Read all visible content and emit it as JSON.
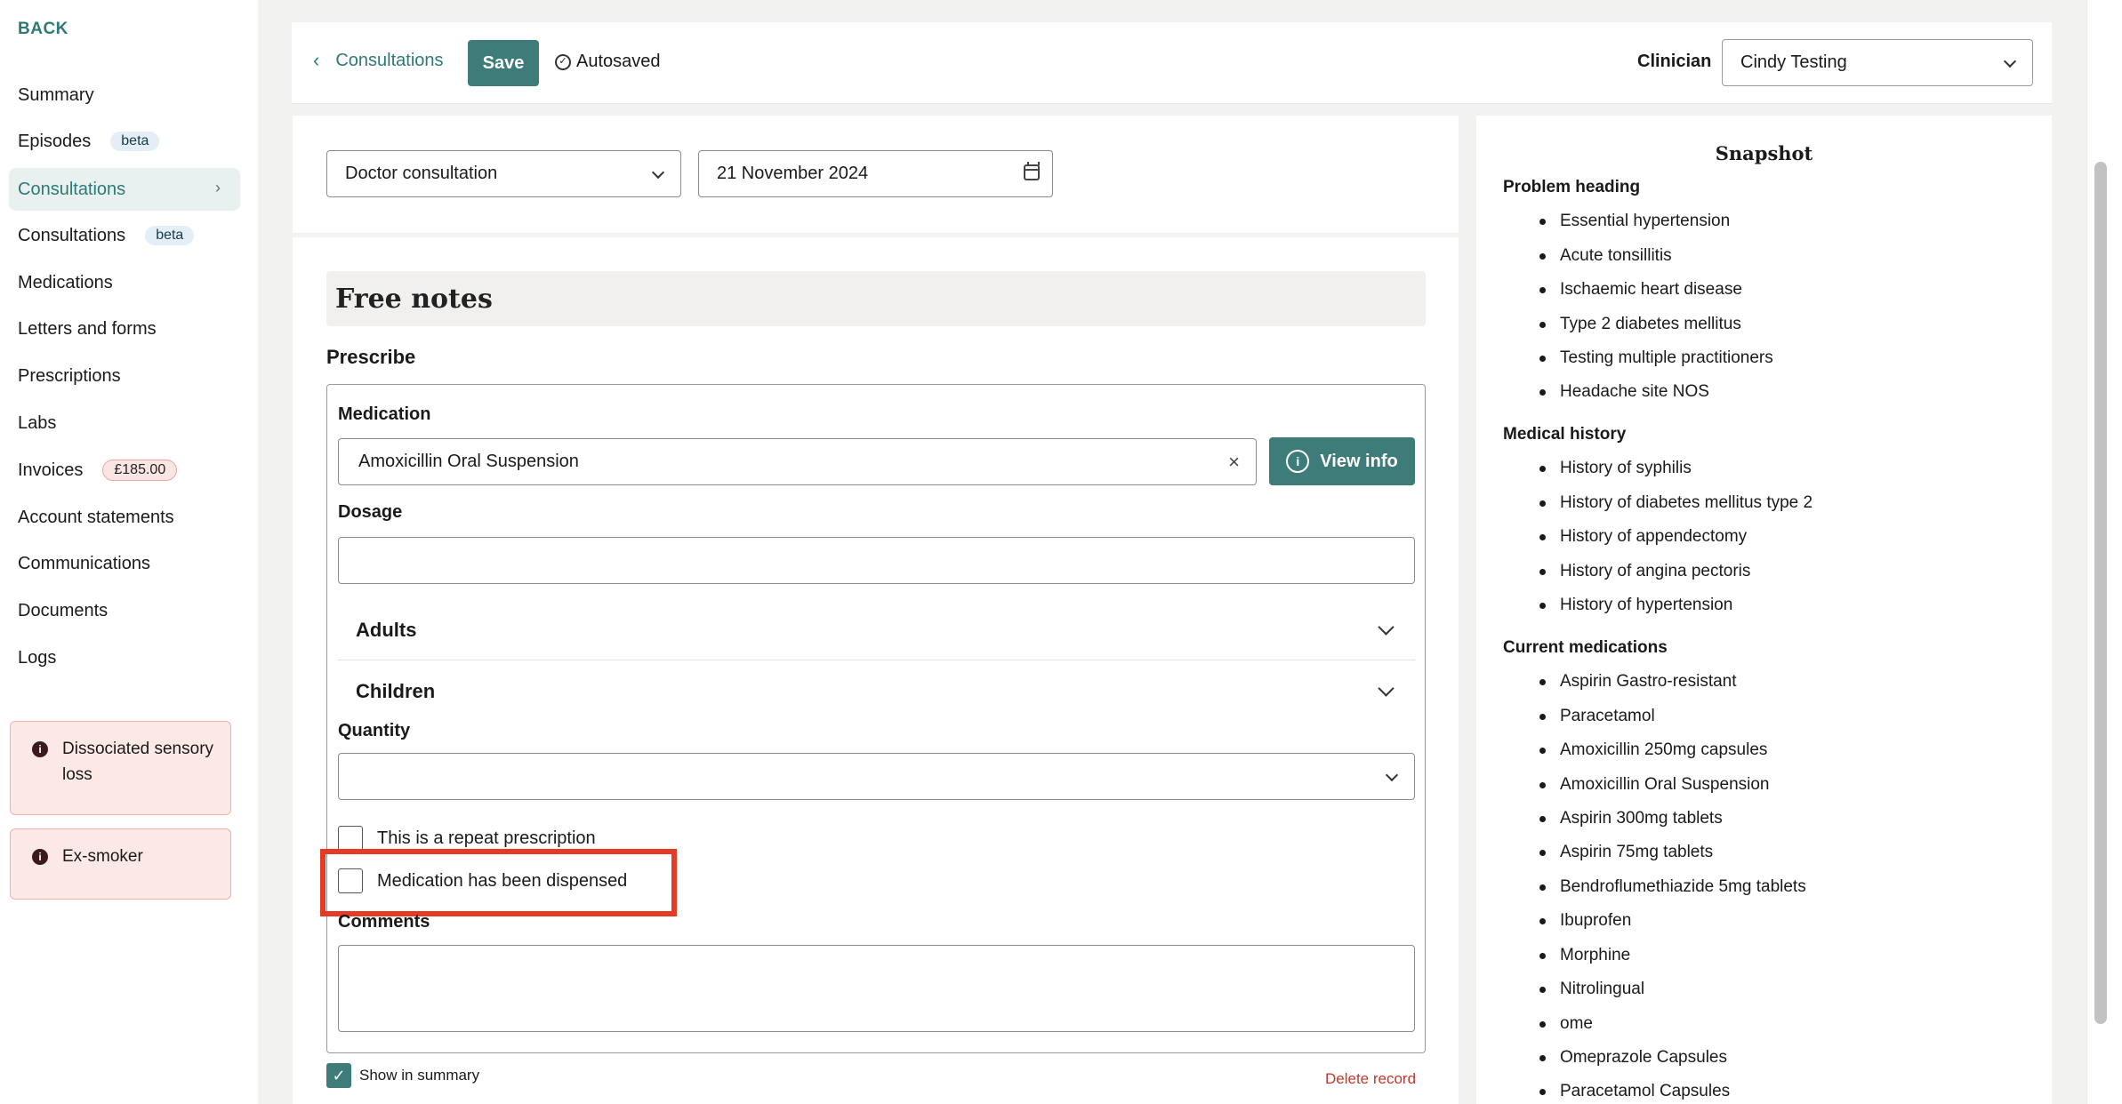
{
  "sidebar": {
    "back_label": "BACK",
    "nav": [
      {
        "label": "Summary",
        "badge": ""
      },
      {
        "label": "Episodes",
        "badge": "beta"
      },
      {
        "label": "Consultations",
        "badge": ""
      },
      {
        "label": "Consultations",
        "badge": "beta"
      },
      {
        "label": "Medications",
        "badge": ""
      },
      {
        "label": "Letters and forms",
        "badge": ""
      },
      {
        "label": "Prescriptions",
        "badge": ""
      },
      {
        "label": "Labs",
        "badge": ""
      },
      {
        "label": "Invoices",
        "badge": "£185.00"
      },
      {
        "label": "Account statements",
        "badge": ""
      },
      {
        "label": "Communications",
        "badge": ""
      },
      {
        "label": "Documents",
        "badge": ""
      },
      {
        "label": "Logs",
        "badge": ""
      }
    ],
    "chevron": "›",
    "alerts": [
      "Dissociated sensory loss",
      "Ex-smoker"
    ]
  },
  "header": {
    "back_link": "Consultations",
    "save_label": "Save",
    "autosaved": "Autosaved",
    "clinician_label": "Clinician",
    "clinician_value": "Cindy Testing"
  },
  "consultation": {
    "type": "Doctor consultation",
    "date": "21 November 2024"
  },
  "form": {
    "free_notes_title": "Free notes",
    "prescribe_title": "Prescribe",
    "medication_label": "Medication",
    "medication_value": "Amoxicillin Oral Suspension",
    "clear_icon": "×",
    "view_info_label": "View info",
    "dosage_label": "Dosage",
    "adults_label": "Adults",
    "children_label": "Children",
    "quantity_label": "Quantity",
    "repeat_label": "This is a repeat prescription",
    "dispensed_label": "Medication has been dispensed",
    "comments_label": "Comments",
    "show_in_summary_label": "Show in summary",
    "delete_label": "Delete record"
  },
  "snapshot": {
    "title": "Snapshot",
    "sections": [
      {
        "heading": "Problem heading",
        "items": [
          "Essential hypertension",
          "Acute tonsillitis",
          "Ischaemic heart disease",
          "Type 2 diabetes mellitus",
          "Testing multiple practitioners",
          "Headache site NOS"
        ]
      },
      {
        "heading": "Medical history",
        "items": [
          "History of syphilis",
          "History of diabetes mellitus type 2",
          "History of appendectomy",
          "History of angina pectoris",
          "History of hypertension"
        ]
      },
      {
        "heading": "Current medications",
        "items": [
          "Aspirin Gastro-resistant",
          "Paracetamol",
          "Amoxicillin 250mg capsules",
          "Amoxicillin Oral Suspension",
          "Aspirin 300mg tablets",
          "Aspirin 75mg tablets",
          "Bendroflumethiazide 5mg tablets",
          "Ibuprofen",
          "Morphine",
          "Nitrolingual",
          "ome",
          "Omeprazole Capsules",
          "Paracetamol Capsules"
        ]
      }
    ]
  },
  "colors": {
    "accent": "#3d7c78",
    "alert_bg": "#fce9e6",
    "danger": "#c0392b",
    "highlight": "#e53b24"
  },
  "icons": [
    "chevron-left-icon",
    "check-circle-icon",
    "chevron-down-icon",
    "calendar-icon",
    "clear-icon",
    "info-icon",
    "alert-info-icon",
    "checkmark-icon"
  ]
}
